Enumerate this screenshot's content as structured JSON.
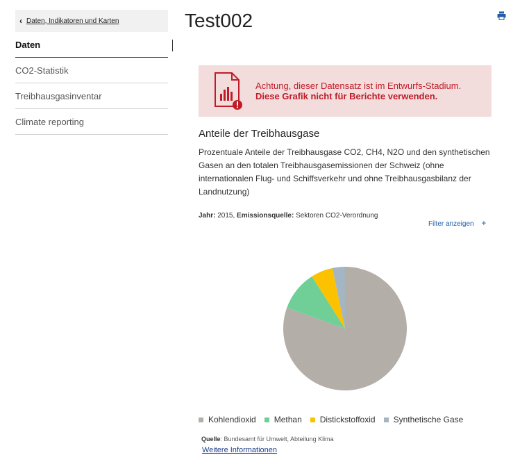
{
  "sidebar": {
    "back_label": "Daten, Indikatoren und Karten",
    "items": [
      {
        "label": "Daten",
        "active": true
      },
      {
        "label": "CO2-Statistik"
      },
      {
        "label": "Treibhausgasinventar"
      },
      {
        "label": "Climate reporting"
      }
    ]
  },
  "page": {
    "title": "Test002"
  },
  "warning": {
    "line1": "Achtung, dieser Datensatz ist im Entwurfs-Stadium.",
    "line2": "Diese Grafik nicht für Berichte verwenden."
  },
  "section": {
    "title": "Anteile der Treibhausgase",
    "description": "Prozentuale Anteile der Treibhausgase CO2, CH4, N2O und den synthetischen Gasen an den totalen Treibhausgasemissionen der Schweiz (ohne internationalen Flug- und Schiffsverkehr und ohne Treibhausgasbilanz der Landnutzung)"
  },
  "meta": {
    "year_label": "Jahr:",
    "year_value": "2015",
    "source_label": "Emissionsquelle:",
    "source_value": "Sektoren CO2-Verordnung"
  },
  "filter": {
    "label": "Filter anzeigen",
    "icon": "+"
  },
  "footer": {
    "source_label": "Quelle",
    "source_value": ": Bundesamt für Umwelt, Abteilung Klima",
    "more_label": "Weitere Informationen"
  },
  "colors": {
    "warning_bg": "#f3dcdc",
    "warning_text": "#c01c28",
    "link": "#1f5ea8"
  },
  "chart_data": {
    "type": "pie",
    "categories": [
      "Kohlendioxid",
      "Methan",
      "Distickstoffoxid",
      "Synthetische Gase"
    ],
    "values": [
      80.5,
      10.5,
      5.7,
      3.3
    ],
    "colors": [
      "#b4aea9",
      "#6fcf97",
      "#fcc200",
      "#a4b6c4"
    ],
    "legend_position": "bottom"
  }
}
